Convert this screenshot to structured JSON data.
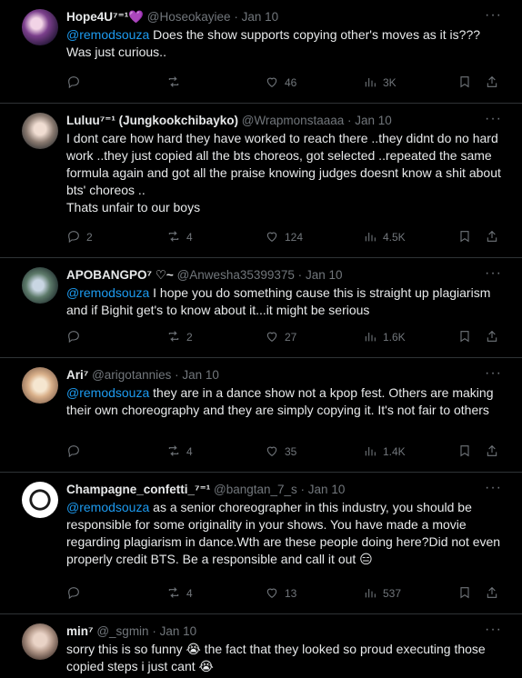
{
  "tweets": [
    {
      "name": "Hope4U⁷⁼¹",
      "name_emoji": "💜",
      "handle": "@Hoseokayiee",
      "date": "Jan 10",
      "mention": "@remodsouza",
      "text": " Does the show supports copying other's moves as it is??? Was just curious..",
      "replies": "",
      "retweets": "",
      "likes": "46",
      "views": "3K"
    },
    {
      "name": "Luluu⁷⁼¹ (Jungkookchibayko)",
      "name_emoji": "",
      "handle": "@Wrapmonstaaaa",
      "date": "Jan 10",
      "mention": "",
      "text": "I dont care how hard they have worked to reach there ..they didnt do no hard work ..they just copied all the bts choreos, got selected ..repeated the same formula again and got all the praise knowing judges doesnt know a shit about bts' choreos ..\nThats unfair to our boys",
      "replies": "2",
      "retweets": "4",
      "likes": "124",
      "views": "4.5K"
    },
    {
      "name": "APOBANGPO⁷ ♡~",
      "name_emoji": "",
      "handle": "@Anwesha35399375",
      "date": "Jan 10",
      "mention": "@remodsouza",
      "text": " I hope you do something cause this is straight up plagiarism and if Bighit get's to know about it...it might be serious",
      "replies": "",
      "retweets": "2",
      "likes": "27",
      "views": "1.6K"
    },
    {
      "name": "Ari⁷",
      "name_emoji": "",
      "handle": "@arigotannies",
      "date": "Jan 10",
      "mention": "@remodsouza",
      "text": " they are in a dance show not a kpop fest. Others are making their own choreography and they are simply copying it. It's not fair to others",
      "replies": "",
      "retweets": "4",
      "likes": "35",
      "views": "1.4K"
    },
    {
      "name": "Champagne_confetti_⁷⁼¹",
      "name_emoji": "",
      "handle": "@bangtan_7_s",
      "date": "Jan 10",
      "mention": "@remodsouza",
      "text": " as a senior choreographer in this industry, you should be responsible for some originality in your shows. You have made a movie regarding plagiarism in dance.Wth are these people doing here?Did not even properly credit BTS. Be a responsible and call it out 😑",
      "replies": "",
      "retweets": "4",
      "likes": "13",
      "views": "537"
    },
    {
      "name": "min⁷",
      "name_emoji": "",
      "handle": "@_sgmin",
      "date": "Jan 10",
      "mention": "",
      "text": "sorry this is so funny 😭 the fact that they looked so proud executing those copied steps i just cant 😭",
      "replies": "",
      "retweets": "",
      "likes": "",
      "views": ""
    }
  ],
  "ui": {
    "dot": "·",
    "more": "···"
  },
  "icons": [
    "reply-icon",
    "retweet-icon",
    "like-icon",
    "views-icon",
    "bookmark-icon",
    "share-icon",
    "more-icon"
  ]
}
